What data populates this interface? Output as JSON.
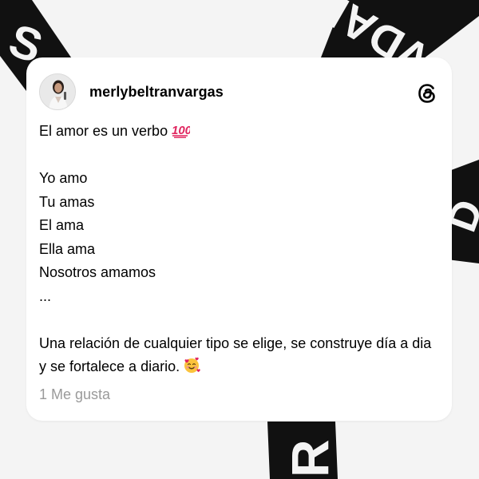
{
  "post": {
    "username": "merlybeltranvargas",
    "line1": "El amor es un verbo",
    "line2": "Yo amo",
    "line3": "Tu amas",
    "line4": "El ama",
    "line5": "Ella ama",
    "line6": "Nosotros amamos",
    "line7": "...",
    "paragraph": "Una relación de cualquier tipo se elige, se construye día a dia y se fortalece a diario.",
    "likes": "1 Me gusta"
  },
  "icons": {
    "hundred": "hundred-points-icon",
    "smiling_hearts": "smiling-face-with-hearts-icon",
    "threads": "threads-logo-icon"
  },
  "colors": {
    "background": "#f4f4f4",
    "card": "#ffffff",
    "text": "#000000",
    "muted": "#9a9a9a",
    "emoji_red": "#e0245e"
  }
}
